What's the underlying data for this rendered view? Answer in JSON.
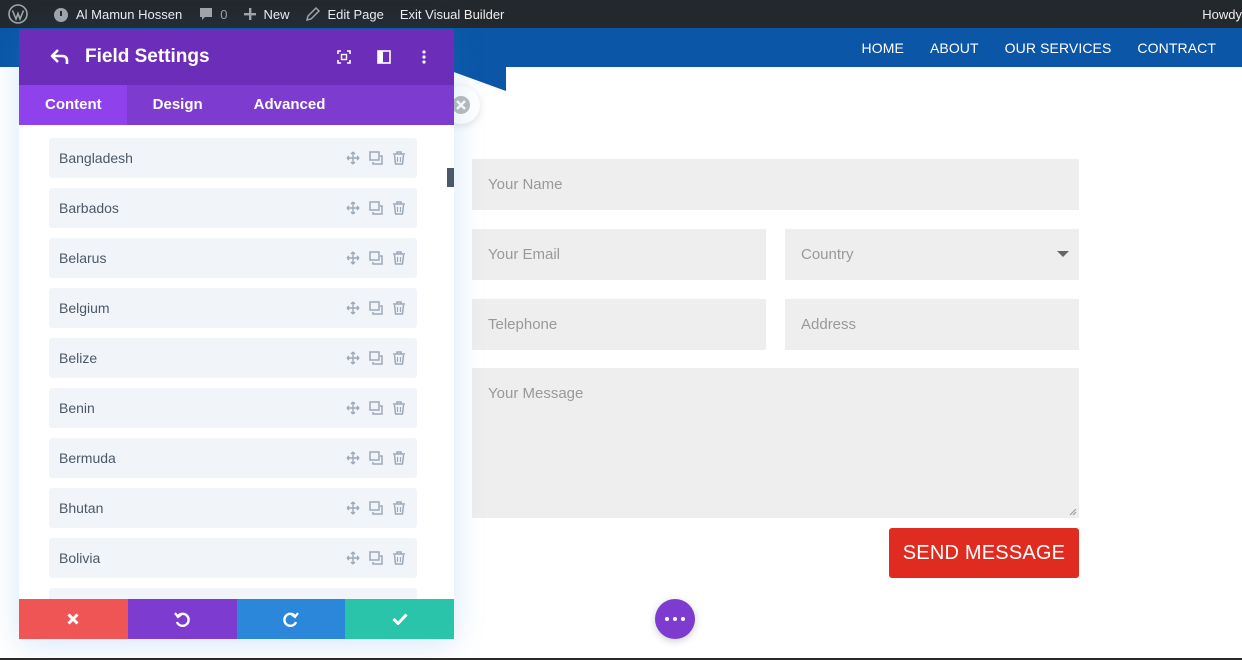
{
  "adminbar": {
    "site_name": "Al Mamun Hossen",
    "comment_count": "0",
    "new_label": "New",
    "edit_label": "Edit Page",
    "exit_label": "Exit Visual Builder",
    "howdy": "Howdy"
  },
  "nav": [
    "HOME",
    "ABOUT",
    "OUR SERVICES",
    "CONTRACT"
  ],
  "panel": {
    "title": "Field Settings",
    "tabs": [
      "Content",
      "Design",
      "Advanced"
    ],
    "options": [
      "Bangladesh",
      "Barbados",
      "Belarus",
      "Belgium",
      "Belize",
      "Benin",
      "Bermuda",
      "Bhutan",
      "Bolivia"
    ]
  },
  "form": {
    "name_placeholder": "Your Name",
    "email_placeholder": "Your Email",
    "country_placeholder": "Country",
    "telephone_placeholder": "Telephone",
    "address_placeholder": "Address",
    "message_placeholder": "Your Message",
    "send_label": "SEND MESSAGE"
  },
  "colors": {
    "admin_bar": "#23282d",
    "header_blue": "#0b56a6",
    "panel_purple": "#6c2eb9",
    "tab_purple": "#7e3bd0",
    "send_red": "#e02b20",
    "cancel_red": "#ef5555",
    "redo_blue": "#2b87da",
    "save_green": "#29c4a9"
  }
}
